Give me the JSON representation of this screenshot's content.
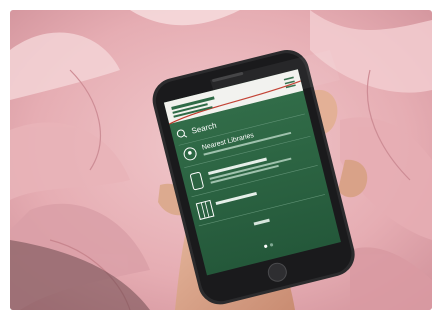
{
  "photo": {
    "subject": "hand-holding-smartphone",
    "background": "pink-peony-petals"
  },
  "app": {
    "logo_text": "",
    "menu_icon": "hamburger-icon",
    "search_label": "Search",
    "items": [
      {
        "icon": "map-pin-icon",
        "title": "Nearest Libraries",
        "subtitle": ""
      },
      {
        "icon": "phone-icon",
        "title": "",
        "subtitle": ""
      },
      {
        "icon": "map-icon",
        "title": "",
        "subtitle": ""
      }
    ],
    "footer_label": "",
    "page_dots": 2,
    "active_dot": 0
  },
  "colors": {
    "screen_green": "#2f6b47",
    "screen_green_dark": "#1f4f33",
    "header_white": "#f2f2ee",
    "accent_red": "#c0392b"
  }
}
